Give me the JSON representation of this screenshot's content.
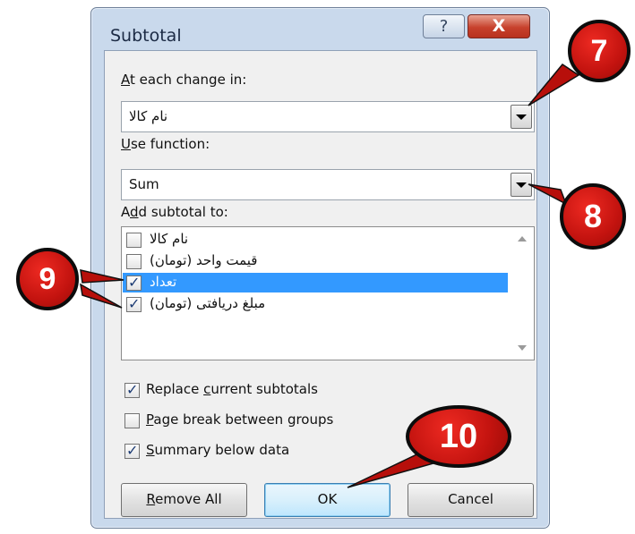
{
  "dialog": {
    "title": "Subtotal",
    "help_symbol": "?",
    "close_symbol": "X"
  },
  "at_each_change": {
    "label_accel": "A",
    "label_rest": "t each change in:",
    "value": "نام کالا"
  },
  "use_function": {
    "label_accel": "U",
    "label_rest": "se function:",
    "value": "Sum"
  },
  "add_subtotal": {
    "label_pre": "A",
    "label_accel": "d",
    "label_rest": "d subtotal to:",
    "items": [
      {
        "label": "نام کالا",
        "checked": false,
        "selected": false
      },
      {
        "label": "قیمت واحد (تومان)",
        "checked": false,
        "selected": false
      },
      {
        "label": "تعداد",
        "checked": true,
        "selected": true
      },
      {
        "label": "مبلغ دریافتی (تومان)",
        "checked": true,
        "selected": false
      }
    ]
  },
  "options": {
    "replace": {
      "pre": "Replace ",
      "accel": "c",
      "rest": "urrent subtotals",
      "checked": true
    },
    "page_break": {
      "pre": "",
      "accel": "P",
      "rest": "age break between groups",
      "checked": false
    },
    "summary": {
      "pre": "",
      "accel": "S",
      "rest": "ummary below data",
      "checked": true
    }
  },
  "buttons": {
    "remove_all": {
      "accel": "R",
      "rest": "emove All"
    },
    "ok": "OK",
    "cancel": "Cancel"
  },
  "annotations": [
    "7",
    "8",
    "9",
    "10"
  ],
  "colors": {
    "frame": "#c9d9ec",
    "selection": "#3399ff",
    "badge": "#d41a14",
    "arrow": "#b70f0b"
  }
}
